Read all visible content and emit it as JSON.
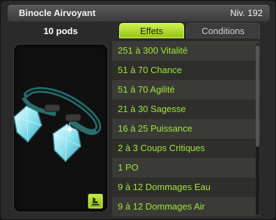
{
  "item": {
    "name": "Binocle Airvoyant",
    "level": "Niv. 192",
    "weight": "10 pods"
  },
  "tabs": {
    "effets": "Effets",
    "conditions": "Conditions"
  },
  "effects": [
    "251 à 300 Vitalité",
    "51 à 70 Chance",
    "51 à 70 Agilité",
    "21 à 30 Sagesse",
    "16 à 25 Puissance",
    "2 à 3 Coups Critiques",
    "1 PO",
    "9 à 12 Dommages Eau",
    "9 à 12 Dommages Air"
  ],
  "colors": {
    "accent": "#a8d42a",
    "effect_text": "#a2e43a"
  },
  "icons": {
    "set_button": "set-icon"
  }
}
